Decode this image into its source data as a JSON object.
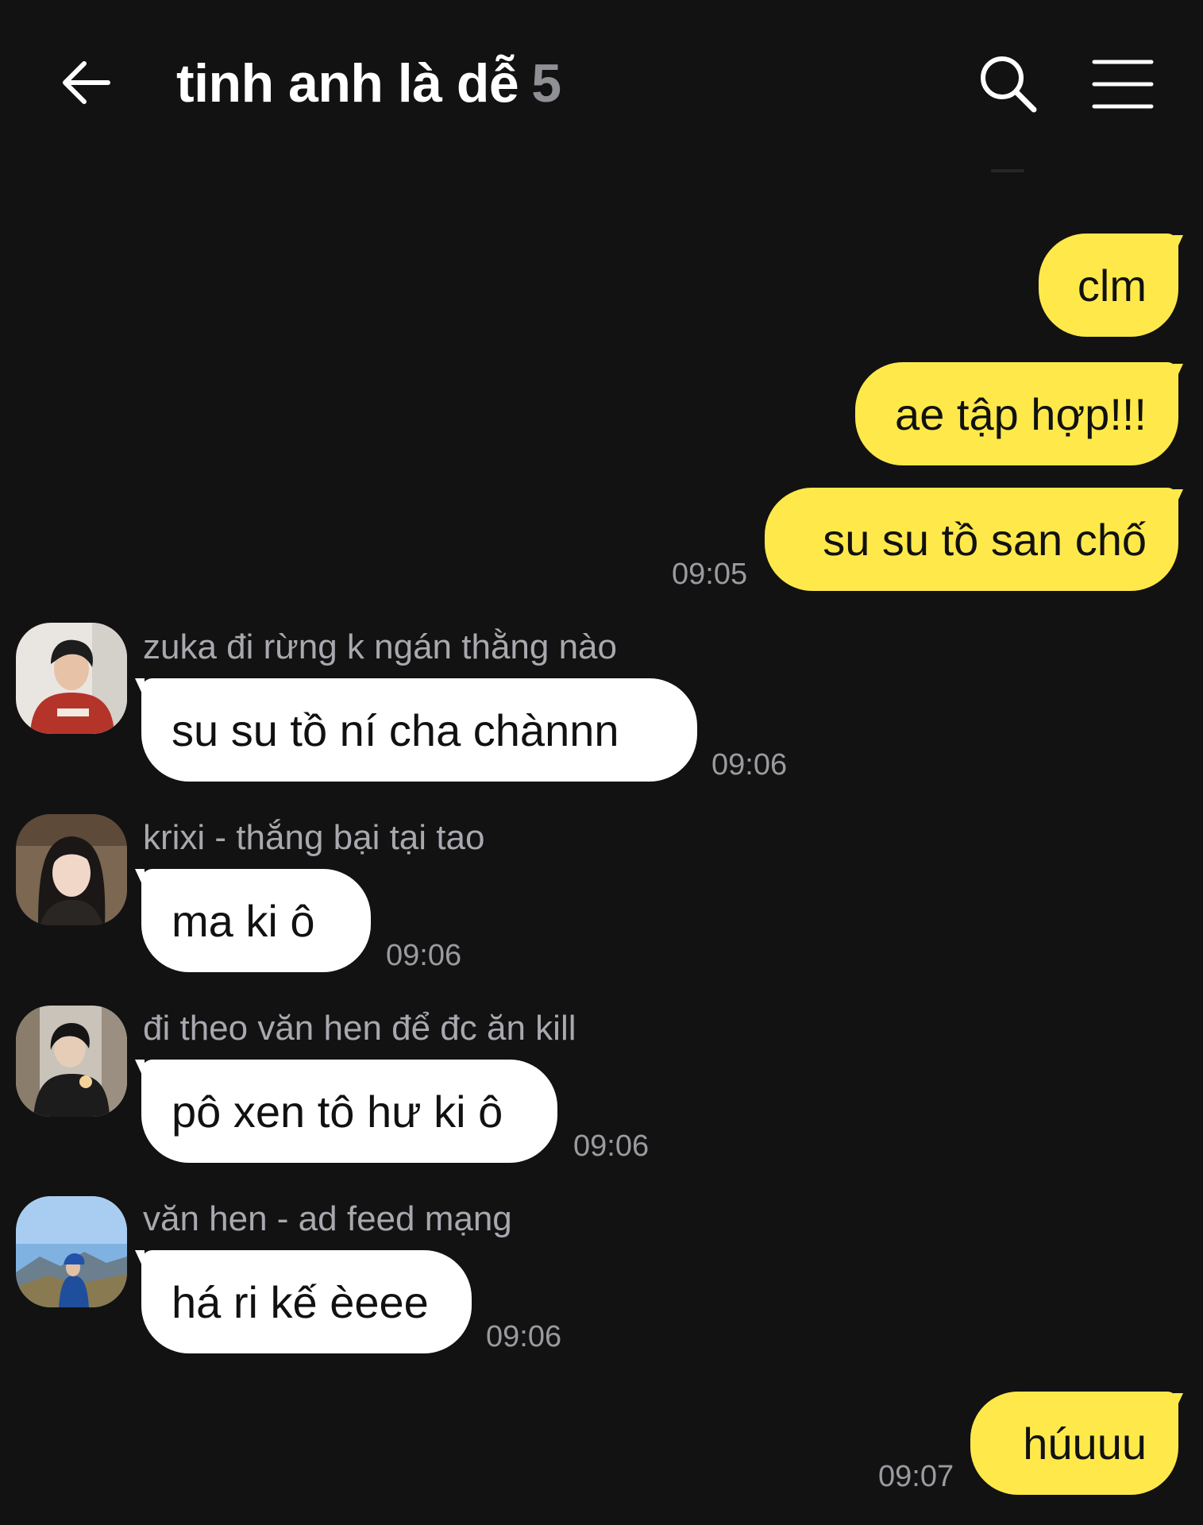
{
  "header": {
    "title": "tinh anh là dễ",
    "member_count": "5",
    "back_icon": "arrow-left-icon",
    "search_icon": "search-icon",
    "menu_icon": "menu-icon"
  },
  "colors": {
    "background": "#121212",
    "outgoing_bubble": "#ffe94a",
    "incoming_bubble": "#ffffff",
    "timestamp": "#9a9aa0",
    "sender_name": "#a8a8ae"
  },
  "messages": [
    {
      "direction": "out",
      "text": "clm"
    },
    {
      "direction": "out",
      "text": "ae tập hợp!!!"
    },
    {
      "direction": "out",
      "text": "su su tồ san chố",
      "time": "09:05"
    },
    {
      "direction": "in",
      "sender": "zuka đi rừng k ngán thằng nào",
      "text": "su su tồ ní cha chànnn",
      "time": "09:06",
      "avatar": "avatar-person-red-hoodie"
    },
    {
      "direction": "in",
      "sender": "krixi - thắng bại tại tao",
      "text": "ma ki ô",
      "time": "09:06",
      "avatar": "avatar-person-black-hair"
    },
    {
      "direction": "in",
      "sender": "đi theo văn hen để đc ăn kill",
      "text": "pô xen tô hư ki ô",
      "time": "09:06",
      "avatar": "avatar-person-street"
    },
    {
      "direction": "in",
      "sender": "văn hen - ad feed mạng",
      "text": "há ri kế èeee",
      "time": "09:06",
      "avatar": "avatar-person-mountain"
    },
    {
      "direction": "out",
      "text": "húuuu",
      "time": "09:07"
    }
  ]
}
